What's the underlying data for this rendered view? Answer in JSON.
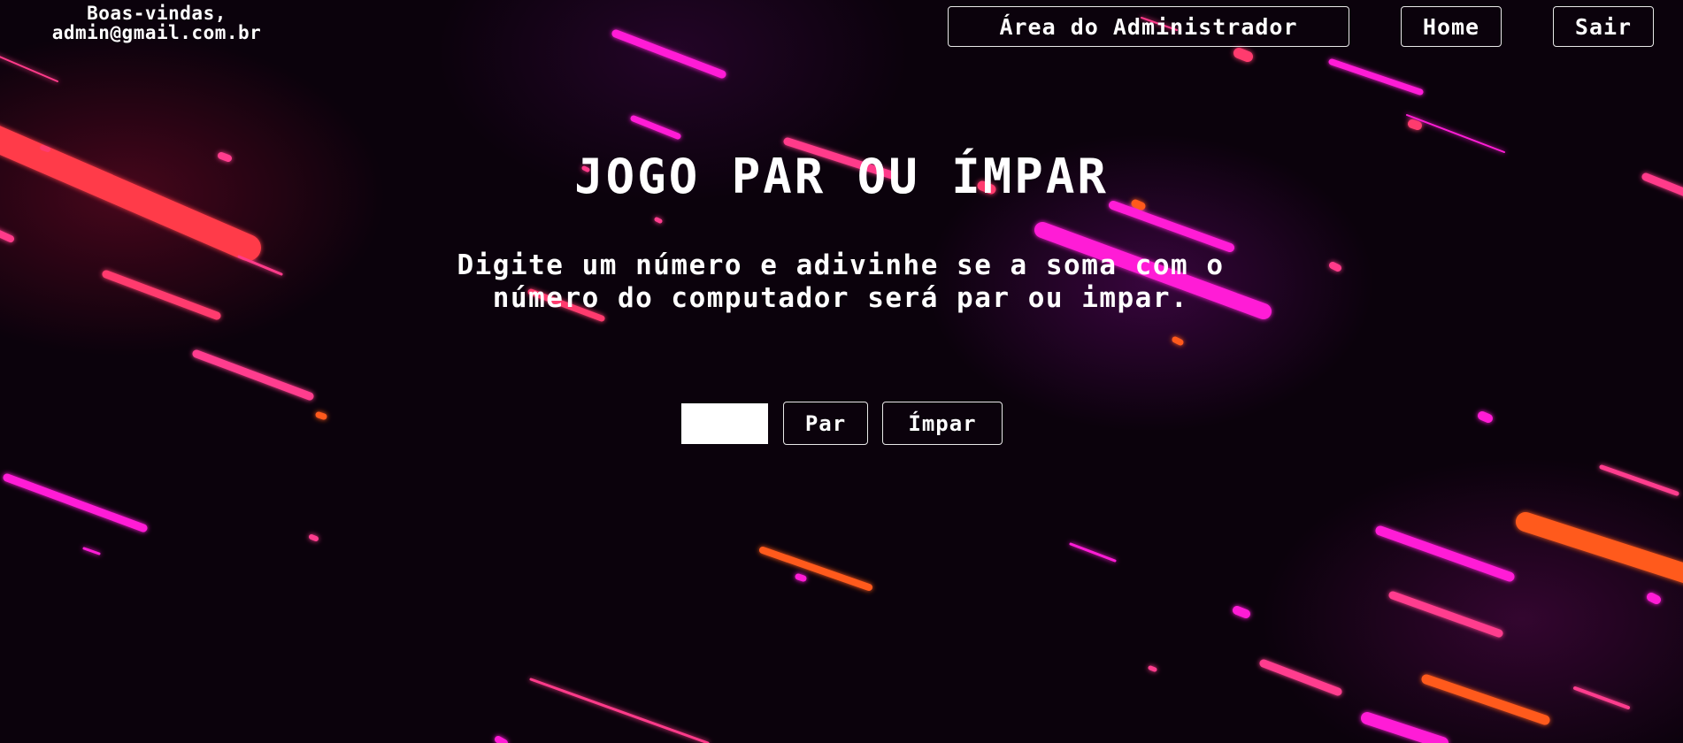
{
  "header": {
    "welcome_line1": "Boas-vindas,",
    "welcome_line2": "admin@gmail.com.br",
    "nav": {
      "admin_label": "Área do Administrador",
      "home_label": "Home",
      "logout_label": "Sair"
    }
  },
  "main": {
    "title": "JOGO PAR OU ÍMPAR",
    "description_line1": "Digite um número e adivinhe se a soma com o",
    "description_line2": "número do computador será par ou impar.",
    "number_input_value": "",
    "even_label": "Par",
    "odd_label": "Ímpar"
  },
  "theme": {
    "background": "#0b020c",
    "accent_magenta": "#ff1fd6",
    "accent_pink": "#ff3c8e",
    "accent_orange": "#ff5a1f",
    "accent_red": "#ff3a4a",
    "text": "#ffffff"
  }
}
